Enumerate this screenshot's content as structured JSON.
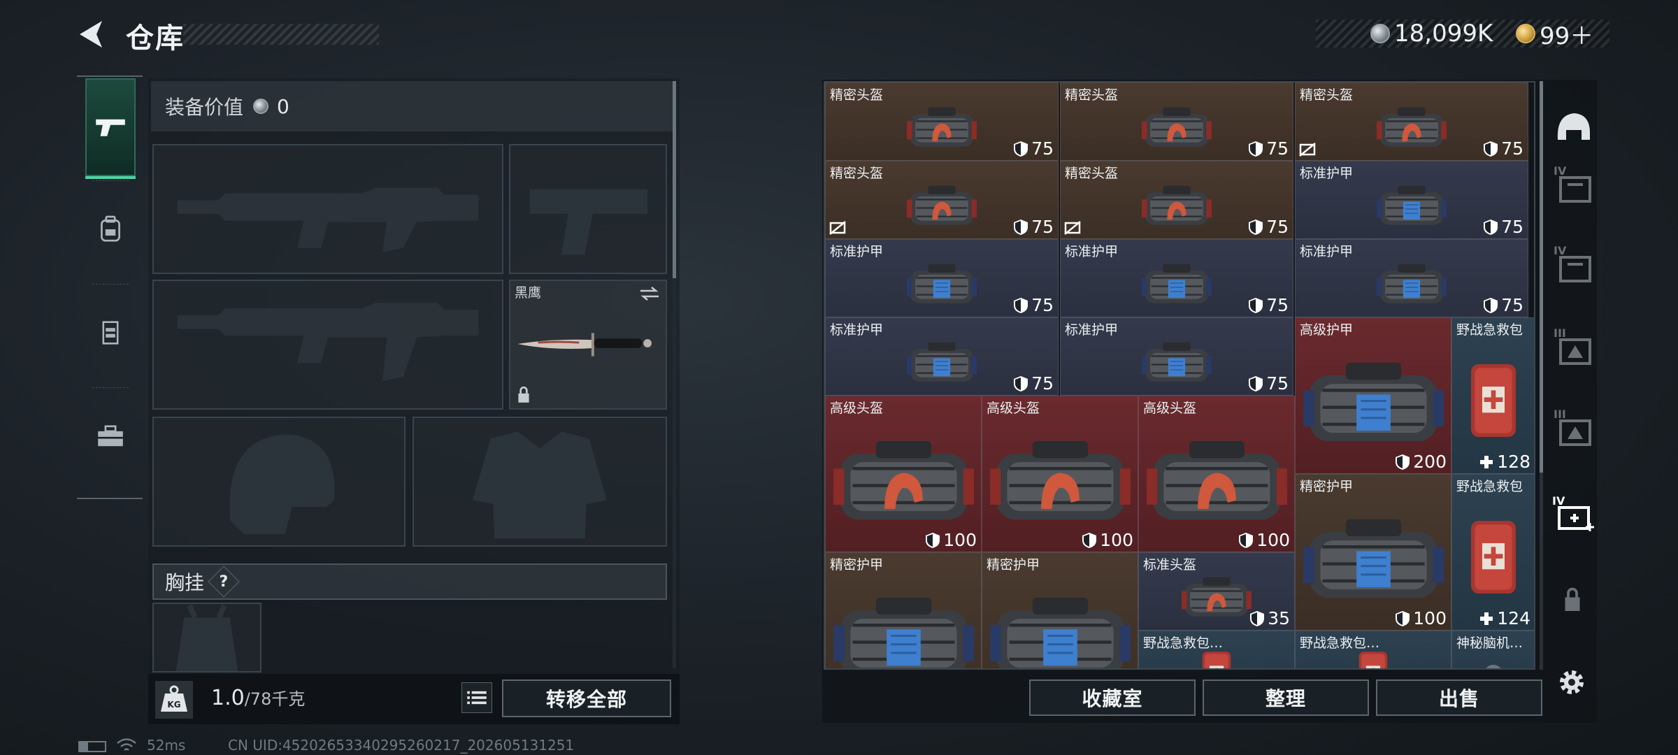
{
  "header": {
    "title": "仓库",
    "currency": [
      {
        "icon": "silver-coin-icon",
        "value": "18,099K"
      },
      {
        "icon": "gold-coin-icon",
        "value": "99＋"
      }
    ]
  },
  "rail": {
    "items": [
      {
        "name": "weapons",
        "icon": "pistol-icon",
        "active": true
      },
      {
        "name": "backpack",
        "icon": "backpack-icon",
        "active": false
      },
      {
        "name": "vest",
        "icon": "vest-icon",
        "active": false
      },
      {
        "name": "toolbox",
        "icon": "toolbox-icon",
        "active": false
      }
    ]
  },
  "loadout": {
    "equip_value_label": "装备价值",
    "equip_value": "0",
    "melee_label": "黑鹰",
    "chest_rig_label": "胸挂",
    "help": "?",
    "weight_value": "1.0",
    "weight_max": "/78千克",
    "transfer_all": "转移全部"
  },
  "inventory": {
    "items": [
      {
        "name": "精密头盔",
        "stat": "75",
        "stat_icon": "shield-icon",
        "kind": "helmet",
        "color": "brown",
        "noins": false
      },
      {
        "name": "精密头盔",
        "stat": "75",
        "stat_icon": "shield-icon",
        "kind": "helmet",
        "color": "brown",
        "noins": false
      },
      {
        "name": "精密头盔",
        "stat": "75",
        "stat_icon": "shield-icon",
        "kind": "helmet",
        "color": "brown",
        "noins": true
      },
      {
        "name": "精密头盔",
        "stat": "75",
        "stat_icon": "shield-icon",
        "kind": "helmet",
        "color": "brown",
        "noins": true
      },
      {
        "name": "精密头盔",
        "stat": "75",
        "stat_icon": "shield-icon",
        "kind": "helmet",
        "color": "brown",
        "noins": true
      },
      {
        "name": "标准护甲",
        "stat": "75",
        "stat_icon": "shield-icon",
        "kind": "armor",
        "color": "navy",
        "noins": false
      },
      {
        "name": "标准护甲",
        "stat": "75",
        "stat_icon": "shield-icon",
        "kind": "armor",
        "color": "navy",
        "noins": false
      },
      {
        "name": "标准护甲",
        "stat": "75",
        "stat_icon": "shield-icon",
        "kind": "armor",
        "color": "navy",
        "noins": false
      },
      {
        "name": "标准护甲",
        "stat": "75",
        "stat_icon": "shield-icon",
        "kind": "armor",
        "color": "navy",
        "noins": false
      },
      {
        "name": "标准护甲",
        "stat": "75",
        "stat_icon": "shield-icon",
        "kind": "armor",
        "color": "navy",
        "noins": false
      },
      {
        "name": "标准护甲",
        "stat": "75",
        "stat_icon": "shield-icon",
        "kind": "armor",
        "color": "navy",
        "noins": false
      },
      {
        "name": "高级护甲",
        "stat": "200",
        "stat_icon": "shield-icon",
        "kind": "armor",
        "color": "red",
        "noins": false
      },
      {
        "name": "野战急救包",
        "stat": "128",
        "stat_icon": "plus-icon",
        "kind": "medkit",
        "color": "teal",
        "noins": false
      },
      {
        "name": "高级头盔",
        "stat": "100",
        "stat_icon": "shield-icon",
        "kind": "helmet",
        "color": "red",
        "noins": false
      },
      {
        "name": "高级头盔",
        "stat": "100",
        "stat_icon": "shield-icon",
        "kind": "helmet",
        "color": "red",
        "noins": false
      },
      {
        "name": "高级头盔",
        "stat": "100",
        "stat_icon": "shield-icon",
        "kind": "helmet",
        "color": "red",
        "noins": false
      },
      {
        "name": "精密护甲",
        "stat": "100",
        "stat_icon": "shield-icon",
        "kind": "armor",
        "color": "brown",
        "noins": false
      },
      {
        "name": "野战急救包",
        "stat": "124",
        "stat_icon": "plus-icon",
        "kind": "medkit",
        "color": "teal",
        "noins": false
      },
      {
        "name": "精密护甲",
        "stat": "",
        "stat_icon": "shield-icon",
        "kind": "armor",
        "color": "brown",
        "noins": false
      },
      {
        "name": "精密护甲",
        "stat": "",
        "stat_icon": "shield-icon",
        "kind": "armor",
        "color": "brown",
        "noins": false
      },
      {
        "name": "标准头盔",
        "stat": "35",
        "stat_icon": "shield-icon",
        "kind": "helmet",
        "color": "navy",
        "noins": false
      },
      {
        "name": "野战急救包…",
        "stat": "",
        "stat_icon": "plus-icon",
        "kind": "medkit",
        "color": "teal",
        "noins": false
      },
      {
        "name": "野战急救包…",
        "stat": "",
        "stat_icon": "plus-icon",
        "kind": "medkit",
        "color": "teal",
        "noins": false
      },
      {
        "name": "神秘脑机…",
        "stat": "",
        "stat_icon": "",
        "kind": "chip",
        "color": "teal",
        "noins": false
      }
    ],
    "buttons": {
      "collection": "收藏室",
      "organize": "整理",
      "sell": "出售"
    },
    "side_tabs": [
      "helmet-category-icon",
      "armor-iv-icon",
      "armor-iv-icon-2",
      "helmet-iii-icon",
      "helmet-iii-icon-2",
      "medkit-iv-icon",
      "lock-icon"
    ]
  },
  "status": {
    "ping": "52ms",
    "uid": "CN UID:45202653340295260217_202605131251"
  }
}
